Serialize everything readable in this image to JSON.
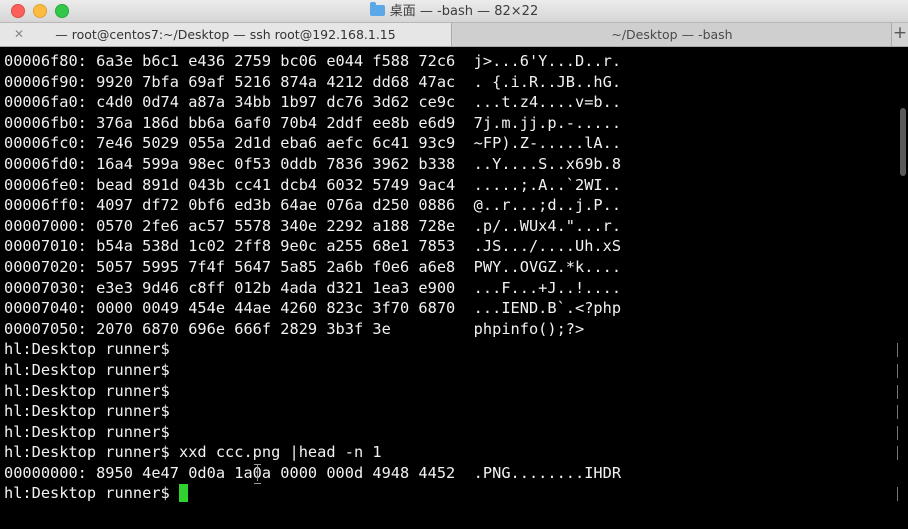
{
  "window": {
    "title": "桌面 — -bash — 82×22",
    "colors": {
      "cursor": "#2fd22f",
      "background": "#000000",
      "text": "#f2f2f2"
    }
  },
  "tabs": [
    {
      "label": "— root@centos7:~/Desktop — ssh root@192.168.1.15",
      "active": true
    },
    {
      "label": "~/Desktop — -bash",
      "active": false
    }
  ],
  "tab_add_label": "+",
  "terminal": {
    "lines": [
      "00006f80: 6a3e b6c1 e436 2759 bc06 e044 f588 72c6  j>...6'Y...D..r.",
      "00006f90: 9920 7bfa 69af 5216 874a 4212 dd68 47ac  . {.i.R..JB..hG.",
      "00006fa0: c4d0 0d74 a87a 34bb 1b97 dc76 3d62 ce9c  ...t.z4....v=b..",
      "00006fb0: 376a 186d bb6a 6af0 70b4 2ddf ee8b e6d9  7j.m.jj.p.-.....",
      "00006fc0: 7e46 5029 055a 2d1d eba6 aefc 6c41 93c9  ~FP).Z-.....lA..",
      "00006fd0: 16a4 599a 98ec 0f53 0ddb 7836 3962 b338  ..Y....S..x69b.8",
      "00006fe0: bead 891d 043b cc41 dcb4 6032 5749 9ac4  .....;.A..`2WI..",
      "00006ff0: 4097 df72 0bf6 ed3b 64ae 076a d250 0886  @..r...;d..j.P..",
      "00007000: 0570 2fe6 ac57 5578 340e 2292 a188 728e  .p/..WUx4.\"...r.",
      "00007010: b54a 538d 1c02 2ff8 9e0c a255 68e1 7853  .JS.../....Uh.xS",
      "00007020: 5057 5995 7f4f 5647 5a85 2a6b f0e6 a6e8  PWY..OVGZ.*k....",
      "00007030: e3e3 9d46 c8ff 012b 4ada d321 1ea3 e900  ...F...+J..!....",
      "00007040: 0000 0049 454e 44ae 4260 823c 3f70 6870  ...IEND.B`.<?php",
      "00007050: 2070 6870 696e 666f 2829 3b3f 3e         phpinfo();?>",
      "hl:Desktop runner$",
      "hl:Desktop runner$",
      "hl:Desktop runner$",
      "hl:Desktop runner$",
      "hl:Desktop runner$",
      "hl:Desktop runner$ xxd ccc.png |head -n 1",
      "00000000: 8950 4e47 0d0a 1a0a 0000 000d 4948 4452  .PNG........IHDR",
      "hl:Desktop runner$ "
    ]
  }
}
